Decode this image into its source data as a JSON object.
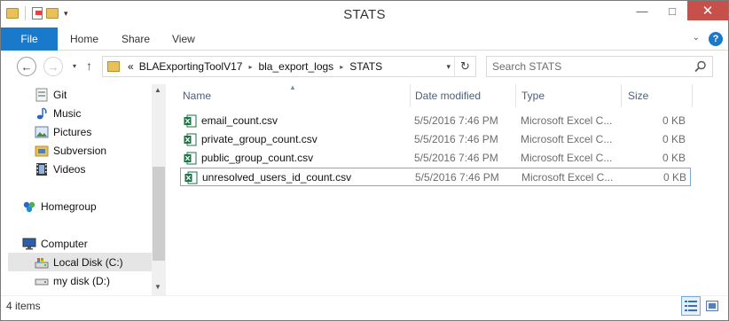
{
  "window": {
    "title": "STATS"
  },
  "ribbon": {
    "tabs": [
      {
        "label": "File"
      },
      {
        "label": "Home"
      },
      {
        "label": "Share"
      },
      {
        "label": "View"
      }
    ],
    "help": "?"
  },
  "address": {
    "overflow": "«",
    "crumbs": [
      "BLAExportingToolV17",
      "bla_export_logs",
      "STATS"
    ]
  },
  "search": {
    "placeholder": "Search STATS"
  },
  "nav": {
    "items": [
      {
        "label": "Git",
        "icon": "git-folder-icon"
      },
      {
        "label": "Music",
        "icon": "music-icon"
      },
      {
        "label": "Pictures",
        "icon": "pictures-icon"
      },
      {
        "label": "Subversion",
        "icon": "subversion-folder-icon"
      },
      {
        "label": "Videos",
        "icon": "videos-icon"
      },
      {
        "label": "Homegroup",
        "icon": "homegroup-icon"
      },
      {
        "label": "Computer",
        "icon": "computer-icon"
      },
      {
        "label": "Local Disk (C:)",
        "icon": "local-disk-icon"
      },
      {
        "label": "my disk (D:)",
        "icon": "drive-icon"
      }
    ]
  },
  "columns": {
    "name": "Name",
    "date": "Date modified",
    "type": "Type",
    "size": "Size"
  },
  "files": [
    {
      "name": "email_count.csv",
      "date": "5/5/2016 7:46 PM",
      "type": "Microsoft Excel C...",
      "size": "0 KB"
    },
    {
      "name": "private_group_count.csv",
      "date": "5/5/2016 7:46 PM",
      "type": "Microsoft Excel C...",
      "size": "0 KB"
    },
    {
      "name": "public_group_count.csv",
      "date": "5/5/2016 7:46 PM",
      "type": "Microsoft Excel C...",
      "size": "0 KB"
    },
    {
      "name": "unresolved_users_id_count.csv",
      "date": "5/5/2016 7:46 PM",
      "type": "Microsoft Excel C...",
      "size": "0 KB"
    }
  ],
  "status": {
    "count": "4 items"
  },
  "colors": {
    "accent": "#1979ca",
    "close": "#c7504a",
    "selection_border": "#7aa7dc",
    "excel_green": "#1e7145"
  }
}
